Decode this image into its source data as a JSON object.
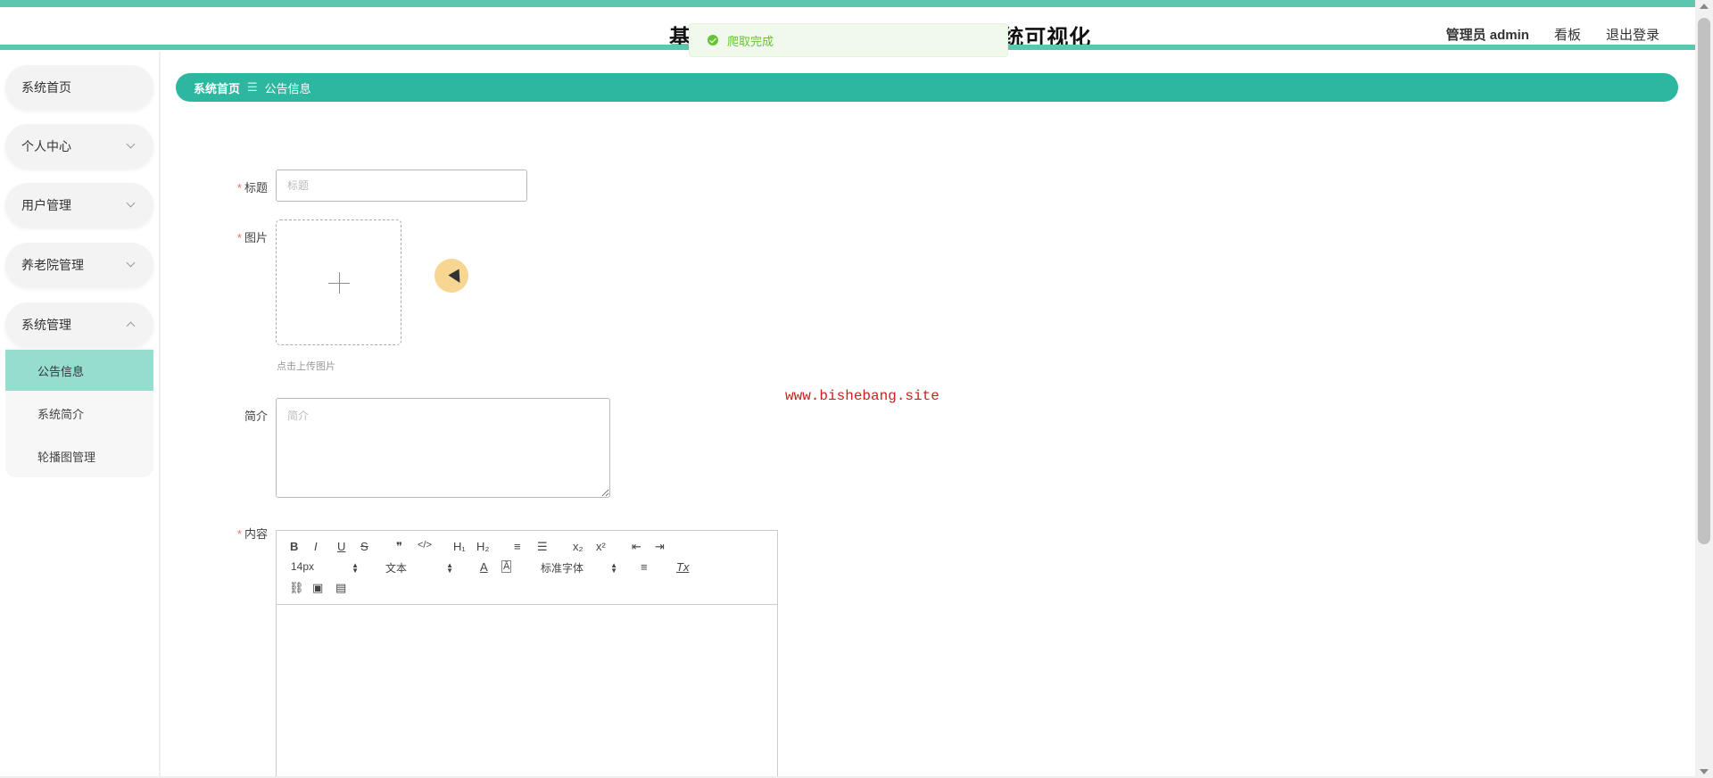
{
  "header": {
    "title": "基于Spring Boot的养老院管理系统可视化",
    "user": "管理员 admin",
    "dashboard_link": "看板",
    "logout_link": "退出登录"
  },
  "toast": {
    "message": "爬取完成"
  },
  "sidebar": {
    "items": [
      {
        "label": "系统首页"
      },
      {
        "label": "个人中心"
      },
      {
        "label": "用户管理"
      },
      {
        "label": "养老院管理"
      },
      {
        "label": "系统管理"
      }
    ],
    "submenu": [
      {
        "label": "公告信息",
        "active": true
      },
      {
        "label": "系统简介"
      },
      {
        "label": "轮播图管理"
      }
    ]
  },
  "breadcrumb": {
    "home": "系统首页",
    "separator": "☰",
    "current": "公告信息"
  },
  "form": {
    "title_label": "标题",
    "title_placeholder": "标题",
    "title_value": "",
    "image_label": "图片",
    "upload_tip": "点击上传图片",
    "intro_label": "简介",
    "intro_placeholder": "简介",
    "content_label": "内容"
  },
  "editor": {
    "font_size": "14px",
    "heading": "文本",
    "font_family": "标准字体",
    "buttons": {
      "bold": "B",
      "italic": "I",
      "underline": "U",
      "strike": "S",
      "quote": "❞",
      "code": "</>",
      "h1": "H₁",
      "h2": "H₂",
      "ordered": "≡",
      "bullet": "☰",
      "sub": "x₂",
      "sup": "x²",
      "outdent": "⇤",
      "indent": "⇥",
      "color": "A",
      "background": "Ā",
      "align": "≡",
      "clean": "Tx",
      "link": "⛓",
      "image": "▣",
      "video": "▤"
    }
  },
  "watermark": "www.bishebang.site",
  "colors": {
    "accent": "#2db7a0",
    "accent_light": "#96ddd0",
    "top_line": "#5cc6ae"
  }
}
